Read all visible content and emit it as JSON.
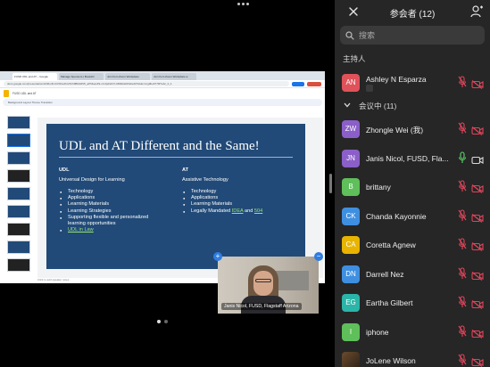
{
  "colors": {
    "panel_bg": "#262626",
    "muted_red": "#e0445a",
    "unmuted_green": "#5fd36b",
    "slide_bg": "#214a78"
  },
  "browser": {
    "tabs": [
      "FUSD UDL and AT – Google",
      "Manage Sponsors | Bookshi",
      "Join from Zoom Workplace",
      "Join from Zoom Workplace a"
    ],
    "url": "docs.google.com/presentation/d/1RurR-KCWhe4hm5Ch9Bt6HPW_aPNkewPk-cznfpdrHNY-0R0kbsDPal/edit?slide=id.g9be6779f7ebc_0_1",
    "doc_title": "FUSD UDL and AT",
    "toolbar": "Background  Layout  Theme  Transition",
    "notes_hint": "Click to add speaker notes"
  },
  "slide": {
    "title": "UDL and AT Different and the Same!",
    "left": {
      "heading": "UDL",
      "subtitle": "Universal Design for Learning",
      "items": [
        "Technology",
        "Applications",
        "Learning Materials",
        "Learning Strategies",
        "Supporting flexible and personalized",
        "learning opportunities"
      ],
      "link": "UDL in Law"
    },
    "right": {
      "heading": "AT",
      "subtitle": "Assistive Technology",
      "items": [
        "Technology",
        "Applications",
        "Learning Materials"
      ],
      "last_prefix": "Legally Mandated ",
      "link1": "IDEA",
      "joiner": " and ",
      "link2": "504"
    }
  },
  "self_view": {
    "name": "Janis Nicol, FUSD, Flagstaff Arizona"
  },
  "panel": {
    "title": "参会者 (12)",
    "search_placeholder": "搜索",
    "host_section": "主持人",
    "meeting_section": "会议中 (11)"
  },
  "participants": [
    {
      "initials": "AN",
      "name": "Ashley N Esparza",
      "color": "#e0525a",
      "mic": "muted",
      "cam": "off",
      "section": "host"
    },
    {
      "initials": "ZW",
      "name": "Zhongle Wei (我)",
      "color": "#8b5fc8",
      "mic": "muted",
      "cam": "off"
    },
    {
      "initials": "JN",
      "name": "Janis Nicol, FUSD, Fla...",
      "color": "#8b5fc8",
      "mic": "on",
      "cam": "on"
    },
    {
      "initials": "B",
      "name": "brittany",
      "color": "#5fbf5a",
      "mic": "muted",
      "cam": "off"
    },
    {
      "initials": "CK",
      "name": "Chanda Kayonnie",
      "color": "#3f8fe0",
      "mic": "muted",
      "cam": "off"
    },
    {
      "initials": "CA",
      "name": "Coretta Agnew",
      "color": "#e8b400",
      "mic": "muted",
      "cam": "off"
    },
    {
      "initials": "DN",
      "name": "Darrell Nez",
      "color": "#3f8fe0",
      "mic": "muted",
      "cam": "off"
    },
    {
      "initials": "EG",
      "name": "Eartha Gilbert",
      "color": "#2bb5a8",
      "mic": "muted",
      "cam": "off"
    },
    {
      "initials": "I",
      "name": "iphone",
      "color": "#5fbf5a",
      "mic": "muted",
      "cam": "off"
    },
    {
      "initials": "",
      "name": "JoLene Wilson",
      "color": "#5a4030",
      "mic": "muted",
      "cam": "off"
    }
  ]
}
